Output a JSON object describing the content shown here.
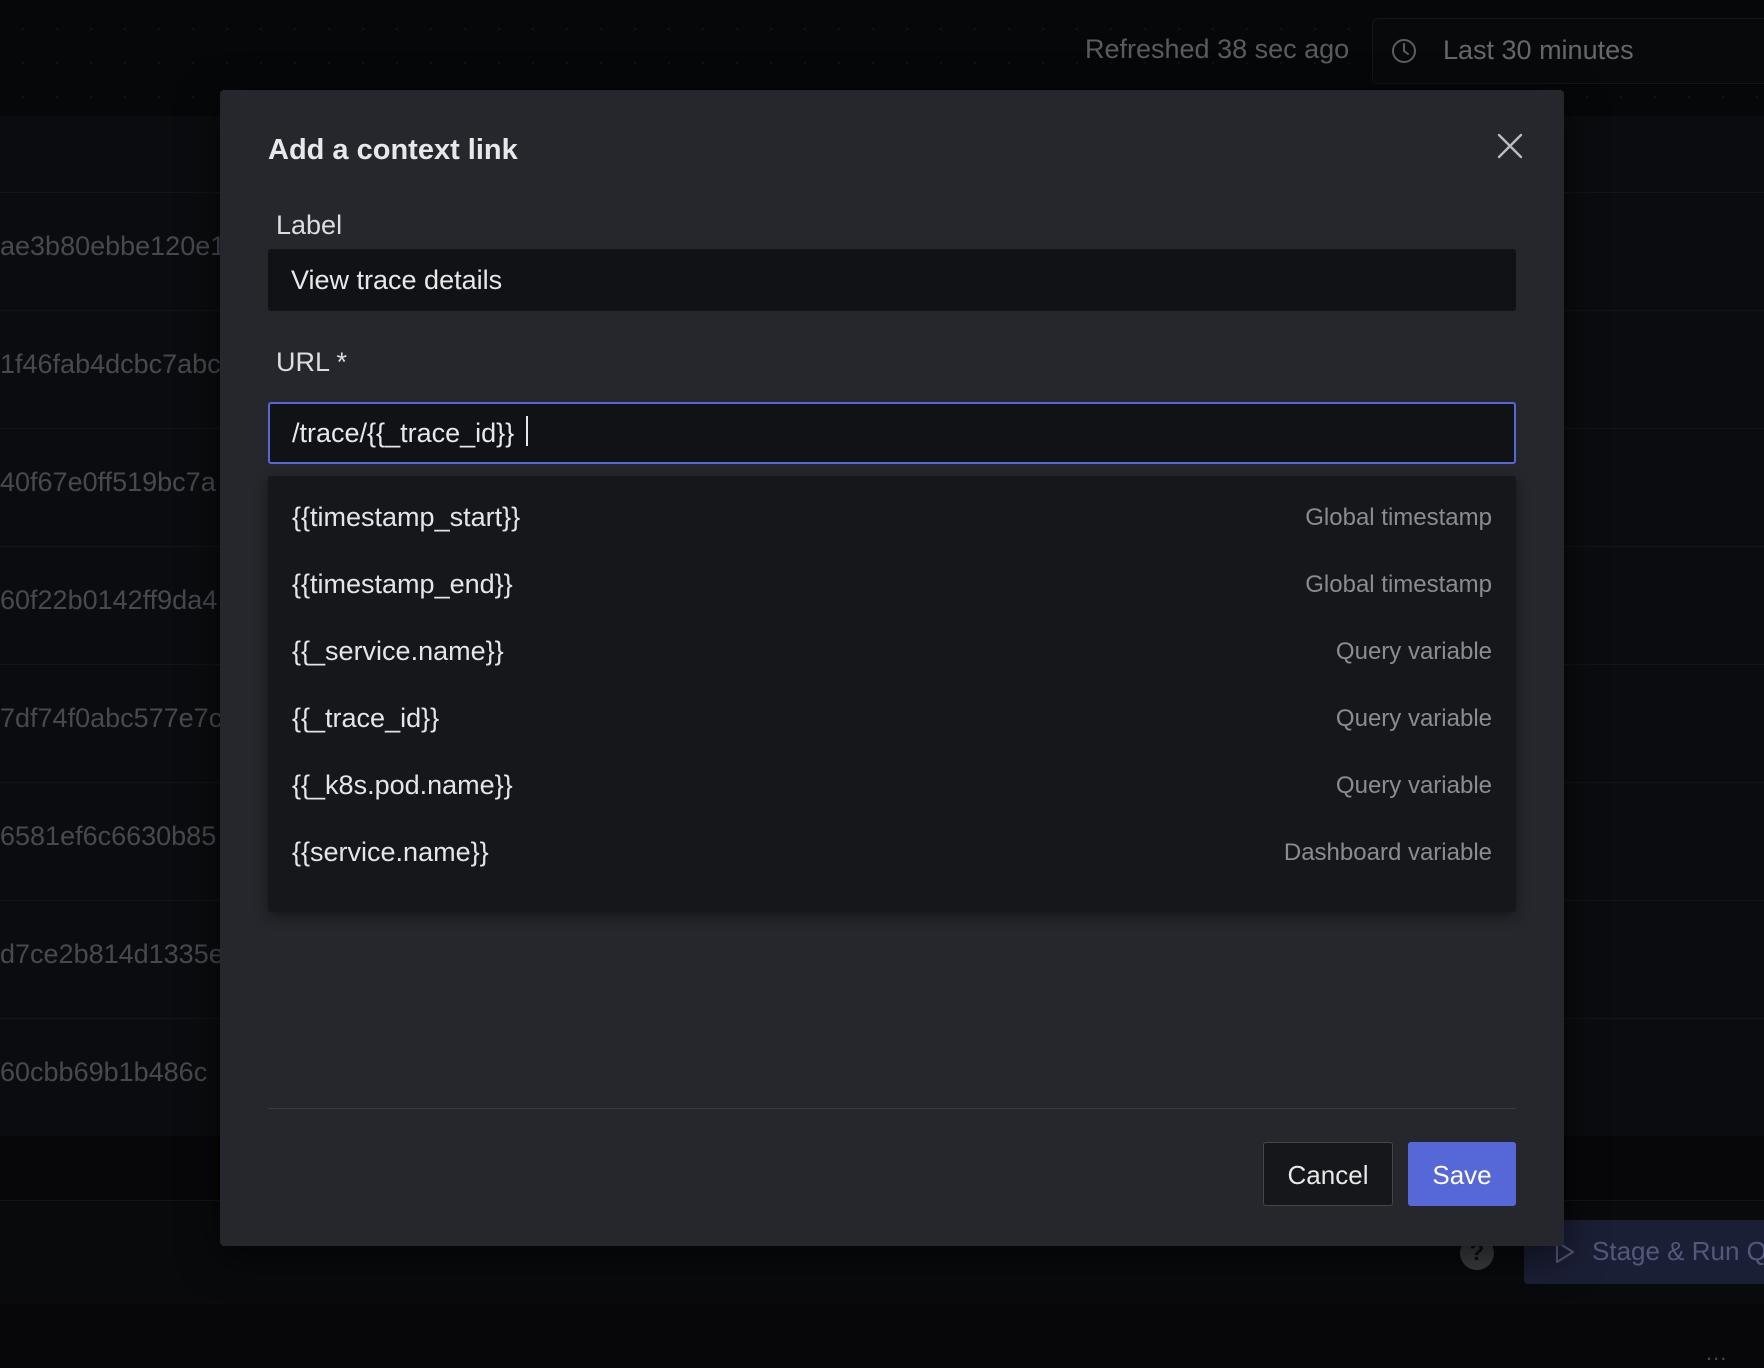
{
  "header": {
    "refreshed_text": "Refreshed 38 sec ago",
    "time_range": "Last 30 minutes"
  },
  "background_table": {
    "rows": [
      "ae3b80ebbe120e1",
      "1f46fab4dcbc7abc",
      "40f67e0ff519bc7a",
      "60f22b0142ff9da4",
      "7df74f0abc577e7c",
      "6581ef6c6630b85",
      "d7ce2b814d1335e",
      "60cbb69b1b486c"
    ]
  },
  "footer": {
    "help_icon": "?",
    "stage_run_label": "Stage & Run Qu",
    "more_icon": "..."
  },
  "modal": {
    "title": "Add a context link",
    "label_field": {
      "label": "Label",
      "value": "View trace details"
    },
    "url_field": {
      "label": "URL *",
      "value": "/trace/{{_trace_id}}"
    },
    "suggestions": [
      {
        "name": "{{timestamp_start}}",
        "type": "Global timestamp"
      },
      {
        "name": "{{timestamp_end}}",
        "type": "Global timestamp"
      },
      {
        "name": "{{_service.name}}",
        "type": "Query variable"
      },
      {
        "name": "{{_trace_id}}",
        "type": "Query variable"
      },
      {
        "name": "{{_k8s.pod.name}}",
        "type": "Query variable"
      },
      {
        "name": "{{service.name}}",
        "type": "Dashboard variable"
      }
    ],
    "cancel_label": "Cancel",
    "save_label": "Save"
  },
  "colors": {
    "accent": "#5667d8",
    "modal_bg": "#26272d",
    "input_bg": "#111216"
  },
  "icons": {
    "clock": "clock-icon",
    "close": "close-icon",
    "help": "help-icon",
    "play": "play-icon"
  }
}
